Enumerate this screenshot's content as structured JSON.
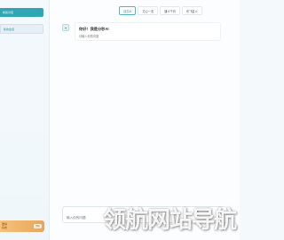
{
  "sidebar": {
    "new_chat_label": "新建对话",
    "conversation_item": "新的会话",
    "promo": {
      "line1": "邀请",
      "line2": "好友",
      "button": "领取"
    }
  },
  "model_tabs": [
    {
      "label": "创意AI",
      "active": true
    },
    {
      "label": "文心一言",
      "active": false
    },
    {
      "label": "通义千问",
      "active": false
    },
    {
      "label": "讯飞星火",
      "active": false
    }
  ],
  "message": {
    "icon": "bot-icon",
    "title": "你好！我是分秒AI",
    "subtitle": "请输入你的问题"
  },
  "input": {
    "placeholder": "输入你的问题"
  },
  "watermark": "领航网站导航",
  "colors": {
    "accent": "#2fa6b6",
    "promo": "#e9a55b"
  }
}
